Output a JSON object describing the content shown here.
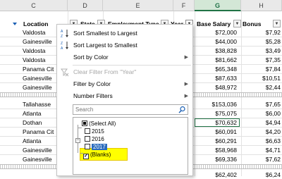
{
  "column_headers": [
    {
      "letter": "C",
      "active": false
    },
    {
      "letter": "D",
      "active": false
    },
    {
      "letter": "E",
      "active": false
    },
    {
      "letter": "F",
      "active": false
    },
    {
      "letter": "G",
      "active": true
    },
    {
      "letter": "H",
      "active": false
    }
  ],
  "table_headers": {
    "location": "Location",
    "state": "State",
    "employment_type": "Employment Type",
    "year": "Year",
    "base_salary": "Base Salary",
    "bonus": "Bonus"
  },
  "rows_top": [
    {
      "location": "Valdosta",
      "salary": "$72,000",
      "bonus": "$7,92"
    },
    {
      "location": "Gainesville",
      "salary": "$44,000",
      "bonus": "$5,28"
    },
    {
      "location": "Valdosta",
      "salary": "$38,828",
      "bonus": "$3,49"
    },
    {
      "location": "Valdosta",
      "salary": "$81,662",
      "bonus": "$7,35"
    },
    {
      "location": "Panama Cit",
      "salary": "$65,348",
      "bonus": "$7,84"
    },
    {
      "location": "Gainesville",
      "salary": "$87,633",
      "bonus": "$10,51"
    },
    {
      "location": "Gainesville",
      "salary": "$48,972",
      "bonus": "$2,44"
    }
  ],
  "rows_bottom": [
    {
      "location": "Tallahasse",
      "salary": "$153,036",
      "bonus": "$7,65"
    },
    {
      "location": "Atlanta",
      "salary": "$75,075",
      "bonus": "$6,00"
    },
    {
      "location": "Dothan",
      "salary": "$70,632",
      "bonus": "$4,94"
    },
    {
      "location": "Panama Cit",
      "salary": "$60,091",
      "bonus": "$4,20"
    },
    {
      "location": "Atlanta",
      "salary": "$60,291",
      "bonus": "$6,63"
    },
    {
      "location": "Gainesville",
      "salary": "$58,968",
      "bonus": "$4,71"
    },
    {
      "location": "Gainesville",
      "salary": "$69,336",
      "bonus": "$7,62"
    }
  ],
  "row_last": {
    "salary": "$62,402",
    "bonus": "$6,24"
  },
  "menu": {
    "sort_smallest": "Sort Smallest to Largest",
    "sort_largest": "Sort Largest to Smallest",
    "sort_by_color": "Sort by Color",
    "clear_filter": "Clear Filter From \"Year\"",
    "filter_by_color": "Filter by Color",
    "number_filters": "Number Filters",
    "search_placeholder": "Search",
    "list": [
      {
        "label": "(Select All)",
        "state": "partial"
      },
      {
        "label": "2015",
        "state": "unchecked"
      },
      {
        "label": "2016",
        "state": "unchecked"
      },
      {
        "label": "2017",
        "state": "unchecked"
      },
      {
        "label": "(Blanks)",
        "state": "checked"
      }
    ]
  },
  "colors": {
    "excel_green": "#217346",
    "highlight_yellow": "#ffff00",
    "selection_blue": "#2b6cbd"
  },
  "icons": [
    "sort-asc-icon",
    "sort-desc-icon",
    "clear-filter-icon",
    "search-icon",
    "filter-dropdown-icon",
    "submenu-arrow-icon"
  ]
}
